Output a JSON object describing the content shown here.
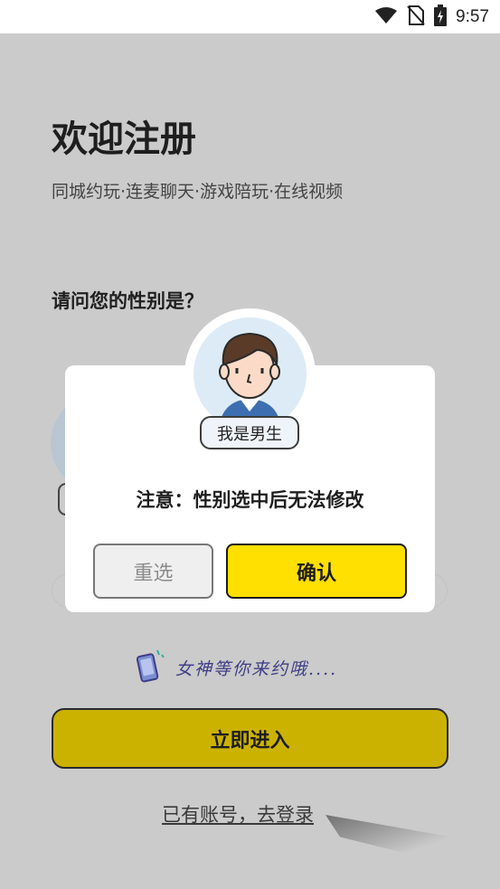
{
  "status_bar": {
    "time": "9:57",
    "icons": [
      "wifi-icon",
      "no-sim-icon",
      "battery-charging-icon"
    ]
  },
  "header": {
    "title": "欢迎注册",
    "subtitle": "同城约玩·连麦聊天·游戏陪玩·在线视频"
  },
  "form": {
    "question": "请问您的性别是？"
  },
  "hint": {
    "icon": "phone-icon",
    "text": "女神等你来约哦...."
  },
  "actions": {
    "enter_label": "立即进入",
    "login_link": "已有账号，去登录"
  },
  "dialog": {
    "avatar_icon": "male-avatar-icon",
    "gender_label": "我是男生",
    "notice": "注意：性别选中后无法修改",
    "reselect_label": "重选",
    "confirm_label": "确认"
  },
  "colors": {
    "overlay_bg": "#cbcbcb",
    "primary_yellow": "#ffe000",
    "primary_yellow_dimmed": "#ccb200",
    "avatar_bg": "#dcebf6",
    "hint_text": "#3f3d86"
  }
}
